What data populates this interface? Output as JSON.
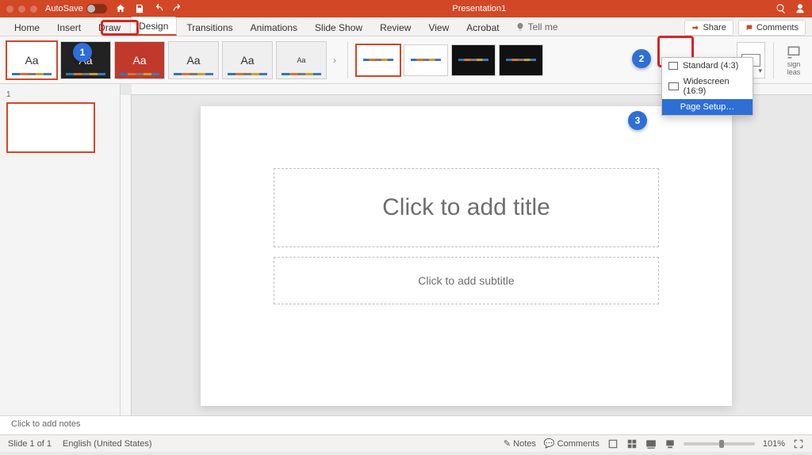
{
  "titlebar": {
    "autosave": "AutoSave",
    "title": "Presentation1"
  },
  "tabs": [
    "Home",
    "Insert",
    "Draw",
    "Design",
    "Transitions",
    "Animations",
    "Slide Show",
    "Review",
    "View",
    "Acrobat"
  ],
  "active_tab": "Design",
  "tellme": "Tell me",
  "share": "Share",
  "comments": "Comments",
  "themes_aa": [
    "Aa",
    "Aa",
    "Aa",
    "Aa",
    "Aa",
    "Aa"
  ],
  "size_menu": {
    "standard": "Standard (4:3)",
    "widescreen": "Widescreen (16:9)",
    "page_setup": "Page Setup…"
  },
  "design_ideas_line1": "sign",
  "design_ideas_line2": "leas",
  "thumb_num": "1",
  "title_placeholder": "Click to add title",
  "subtitle_placeholder": "Click to add subtitle",
  "notes_placeholder": "Click to add notes",
  "status": {
    "slide": "Slide 1 of 1",
    "lang": "English (United States)",
    "notes": "Notes",
    "comments_btn": "Comments",
    "zoom": "101%"
  },
  "callouts": [
    "1",
    "2",
    "3"
  ]
}
